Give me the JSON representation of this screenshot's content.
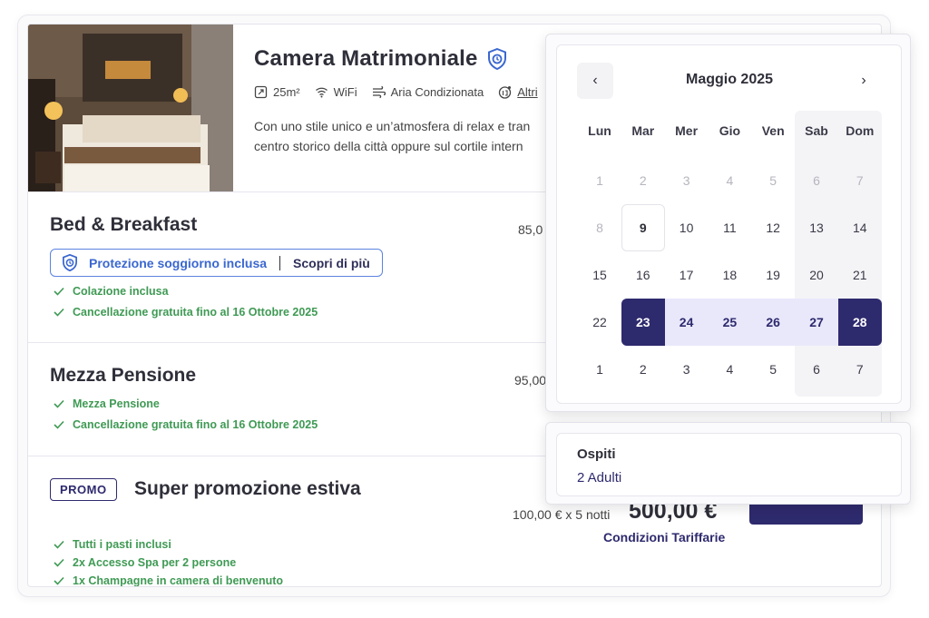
{
  "room": {
    "title": "Camera Matrimoniale",
    "amenities": [
      {
        "icon": "size-icon",
        "label": "25m²"
      },
      {
        "icon": "wifi-icon",
        "label": "WiFi"
      },
      {
        "icon": "air-conditioning-icon",
        "label": "Aria Condizionata"
      },
      {
        "icon": "more-amenities-icon",
        "label": "Altri"
      }
    ],
    "description_line1": "Con uno stile unico e un’atmosfera di relax e tran",
    "description_line2": "centro storico della città oppure sul cortile intern"
  },
  "rates": [
    {
      "title": "Bed & Breakfast",
      "price": "85,0",
      "protection_label": "Protezione soggiorno inclusa",
      "protection_link": "Scopri di più",
      "features": [
        "Colazione inclusa",
        "Cancellazione gratuita fino al 16 Ottobre 2025"
      ]
    },
    {
      "title": "Mezza Pensione",
      "price": "95,00",
      "features": [
        "Mezza Pensione",
        "Cancellazione gratuita fino al 16 Ottobre 2025"
      ]
    },
    {
      "badge": "PROMO",
      "title": "Super promozione estiva",
      "price_calc": "100,00 € x 5 notti",
      "price_total": "500,00 €",
      "conditions_link": "Condizioni Tariffarie",
      "features": [
        "Tutti i pasti inclusi",
        "2x Accesso Spa per 2 persone",
        "1x Champagne in camera di benvenuto"
      ]
    }
  ],
  "calendar": {
    "month": "Maggio 2025",
    "prev": "‹",
    "next": "›",
    "weekdays": [
      "Lun",
      "Mar",
      "Mer",
      "Gio",
      "Ven",
      "Sab",
      "Dom"
    ],
    "weeks": [
      [
        "1",
        "2",
        "3",
        "4",
        "5",
        "6",
        "7"
      ],
      [
        "8",
        "9",
        "10",
        "11",
        "12",
        "13",
        "14"
      ],
      [
        "15",
        "16",
        "17",
        "18",
        "19",
        "20",
        "21"
      ],
      [
        "22",
        "23",
        "24",
        "25",
        "26",
        "27",
        "28"
      ],
      [
        "1",
        "2",
        "3",
        "4",
        "5",
        "6",
        "7"
      ]
    ],
    "muted_days_week1": true,
    "muted_day_week2": "8",
    "today": "9",
    "range_start": "23",
    "range_end": "28"
  },
  "guests": {
    "label": "Ospiti",
    "value": "2 Adulti"
  },
  "colors": {
    "primary": "#2e2a6e",
    "range": "#e9e8fb",
    "success": "#3f9a54",
    "link_blue": "#3a67d0"
  }
}
